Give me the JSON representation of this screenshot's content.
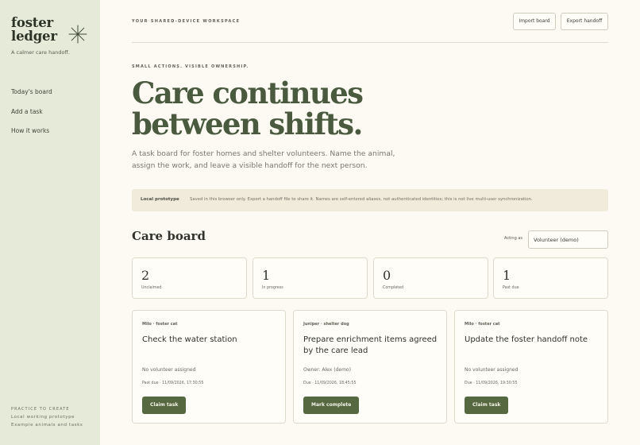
{
  "sidebar": {
    "brand_line1": "foster",
    "brand_line2": "ledger",
    "tagline": "A calmer care handoff.",
    "nav": [
      "Today's board",
      "Add a task",
      "How it works"
    ],
    "footer_title": "PRACTICE TO CREATE",
    "footer_lines": [
      "Local working prototype",
      "Example animals and tasks"
    ]
  },
  "header": {
    "eyebrow": "YOUR SHARED-DEVICE WORKSPACE",
    "import_label": "Import board",
    "export_label": "Export handoff"
  },
  "hero": {
    "kicker": "SMALL ACTIONS. VISIBLE OWNERSHIP.",
    "headline_line1": "Care continues",
    "headline_line2": "between shifts.",
    "lede": "A task board for foster homes and shelter volunteers. Name the animal, assign the work, and leave a visible handoff for the next person."
  },
  "notice": {
    "label": "Local prototype",
    "text": "Saved in this browser only. Export a handoff file to share it. Names are self-entered aliases, not authenticated identities; this is not live multi-user synchronization."
  },
  "board": {
    "title": "Care board",
    "acting_label": "Acting as",
    "acting_value": "Volunteer (demo)",
    "stats": [
      {
        "value": "2",
        "label": "Unclaimed"
      },
      {
        "value": "1",
        "label": "In progress"
      },
      {
        "value": "0",
        "label": "Completed"
      },
      {
        "value": "1",
        "label": "Past due"
      }
    ],
    "tasks": [
      {
        "tag": "Milo · foster cat",
        "title": "Check the water station",
        "owner": "No volunteer assigned",
        "due": "Past due · 11/09/2026, 17:30:55",
        "action": "Claim task"
      },
      {
        "tag": "Juniper · shelter dog",
        "title": "Prepare enrichment items agreed by the care lead",
        "owner": "Owner: Alex (demo)",
        "due": "Due · 11/09/2026, 18:45:55",
        "action": "Mark complete"
      },
      {
        "tag": "Milo · foster cat",
        "title": "Update the foster handoff note",
        "owner": "No volunteer assigned",
        "due": "Due · 11/09/2026, 19:30:55",
        "action": "Claim task"
      }
    ]
  },
  "colors": {
    "sidebar_bg": "#e6ead9",
    "page_bg": "#fdfaf4",
    "accent_green": "#55683f",
    "notice_bg": "#f1ebdc"
  }
}
